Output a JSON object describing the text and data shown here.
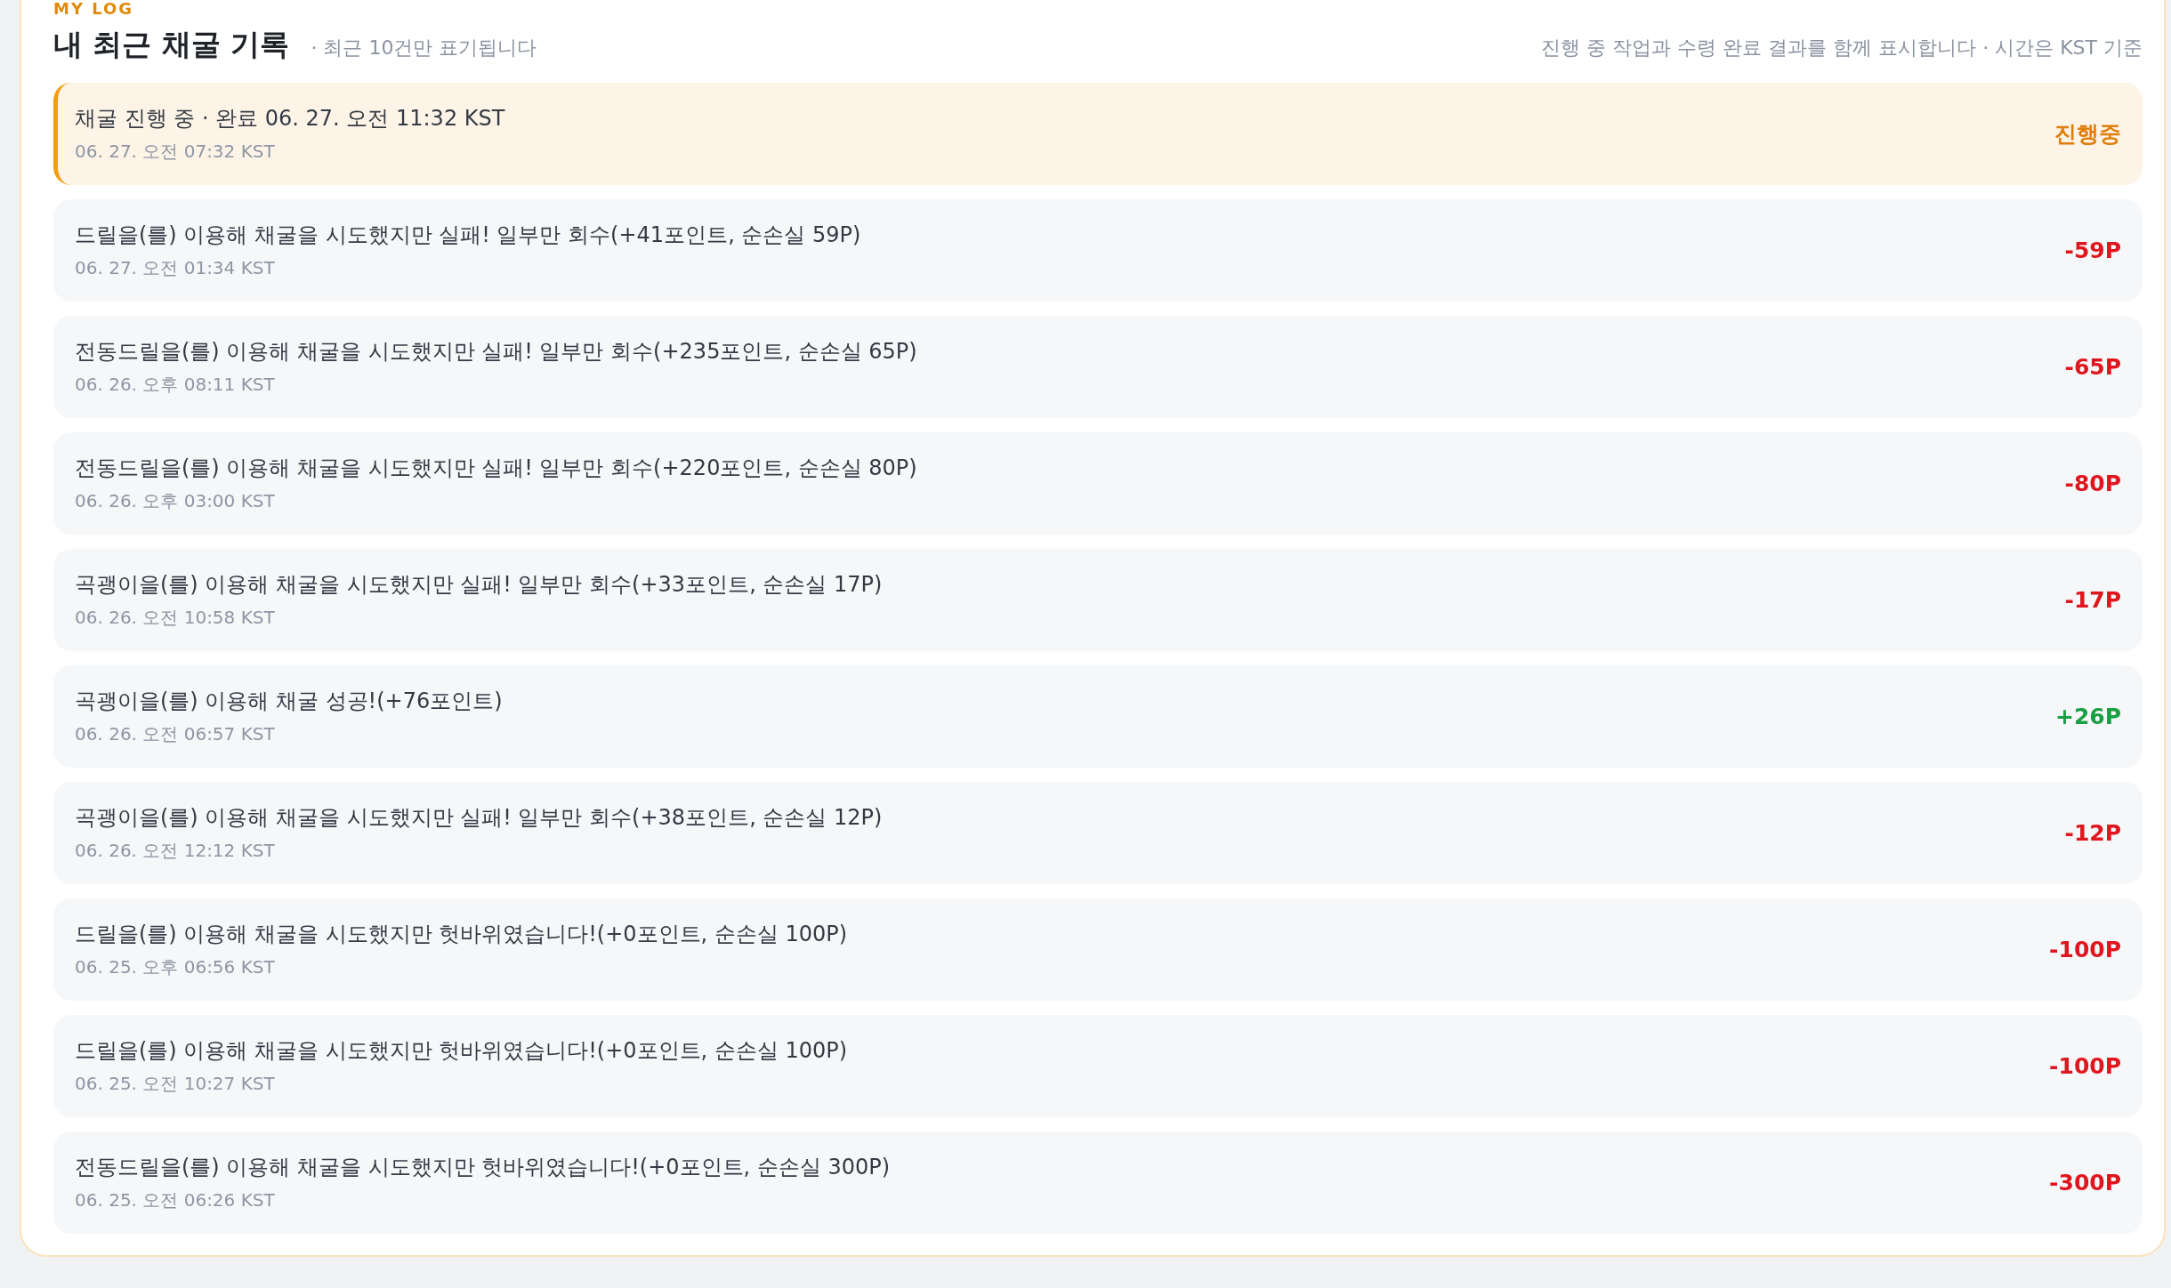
{
  "section_label": "MY LOG",
  "title": "내 최근 채굴 기록",
  "subtitle": "· 최근 10건만 표기됩니다",
  "note": "진행 중 작업과 수령 완료 결과를 함께 표시합니다 · 시간은 KST 기준",
  "entries": [
    {
      "kind": "pending",
      "message": "채굴 진행 중 · 완료 06. 27. 오전 11:32 KST",
      "time": "06. 27. 오전 07:32 KST",
      "amount": "진행중"
    },
    {
      "kind": "loss",
      "message": "드릴을(를) 이용해 채굴을 시도했지만 실패! 일부만 회수(+41포인트, 순손실 59P)",
      "time": "06. 27. 오전 01:34 KST",
      "amount": "-59P"
    },
    {
      "kind": "loss",
      "message": "전동드릴을(를) 이용해 채굴을 시도했지만 실패! 일부만 회수(+235포인트, 순손실 65P)",
      "time": "06. 26. 오후 08:11 KST",
      "amount": "-65P"
    },
    {
      "kind": "loss",
      "message": "전동드릴을(를) 이용해 채굴을 시도했지만 실패! 일부만 회수(+220포인트, 순손실 80P)",
      "time": "06. 26. 오후 03:00 KST",
      "amount": "-80P"
    },
    {
      "kind": "loss",
      "message": "곡괭이을(를) 이용해 채굴을 시도했지만 실패! 일부만 회수(+33포인트, 순손실 17P)",
      "time": "06. 26. 오전 10:58 KST",
      "amount": "-17P"
    },
    {
      "kind": "gain",
      "message": "곡괭이을(를) 이용해 채굴 성공!(+76포인트)",
      "time": "06. 26. 오전 06:57 KST",
      "amount": "+26P"
    },
    {
      "kind": "loss",
      "message": "곡괭이을(를) 이용해 채굴을 시도했지만 실패! 일부만 회수(+38포인트, 순손실 12P)",
      "time": "06. 26. 오전 12:12 KST",
      "amount": "-12P"
    },
    {
      "kind": "loss",
      "message": "드릴을(를) 이용해 채굴을 시도했지만 헛바위였습니다!(+0포인트, 순손실 100P)",
      "time": "06. 25. 오후 06:56 KST",
      "amount": "-100P"
    },
    {
      "kind": "loss",
      "message": "드릴을(를) 이용해 채굴을 시도했지만 헛바위였습니다!(+0포인트, 순손실 100P)",
      "time": "06. 25. 오전 10:27 KST",
      "amount": "-100P"
    },
    {
      "kind": "loss",
      "message": "전동드릴을(를) 이용해 채굴을 시도했지만 헛바위였습니다!(+0포인트, 순손실 300P)",
      "time": "06. 25. 오전 06:26 KST",
      "amount": "-300P"
    }
  ]
}
